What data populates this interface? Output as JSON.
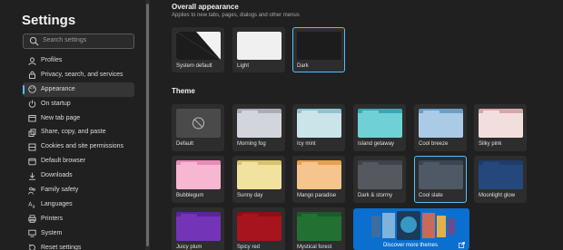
{
  "sidebar": {
    "title": "Settings",
    "search_placeholder": "Search settings",
    "items": [
      {
        "label": "Profiles",
        "icon": "profile-icon"
      },
      {
        "label": "Privacy, search, and services",
        "icon": "lock-icon"
      },
      {
        "label": "Appearance",
        "icon": "palette-icon",
        "active": true
      },
      {
        "label": "On startup",
        "icon": "power-icon"
      },
      {
        "label": "New tab page",
        "icon": "new-tab-icon"
      },
      {
        "label": "Share, copy, and paste",
        "icon": "share-icon"
      },
      {
        "label": "Cookies and site permissions",
        "icon": "cookies-icon"
      },
      {
        "label": "Default browser",
        "icon": "browser-icon"
      },
      {
        "label": "Downloads",
        "icon": "download-icon"
      },
      {
        "label": "Family safety",
        "icon": "family-icon"
      },
      {
        "label": "Languages",
        "icon": "languages-icon"
      },
      {
        "label": "Printers",
        "icon": "printer-icon"
      },
      {
        "label": "System",
        "icon": "system-icon"
      },
      {
        "label": "Reset settings",
        "icon": "reset-icon"
      }
    ]
  },
  "appearance": {
    "heading": "Overall appearance",
    "subtext": "Applies to new tabs, pages, dialogs and other menus",
    "options": [
      {
        "label": "System default",
        "selected": false
      },
      {
        "label": "Light",
        "selected": false
      },
      {
        "label": "Dark",
        "selected": true
      }
    ]
  },
  "theme": {
    "heading": "Theme",
    "items": [
      {
        "label": "Default",
        "colors": {
          "bar": "#4d4d4d",
          "body": "#4d4d4d",
          "tab": "#4d4d4d"
        }
      },
      {
        "label": "Morning fog",
        "colors": {
          "bar": "#a9adb5",
          "body": "#d2d6dc",
          "tab": "#d2d6dc"
        }
      },
      {
        "label": "Icy mint",
        "colors": {
          "bar": "#8fc3d0",
          "body": "#cbe4ea",
          "tab": "#cbe4ea"
        }
      },
      {
        "label": "Island getaway",
        "colors": {
          "bar": "#3aa7b5",
          "body": "#6fd1d6",
          "tab": "#6fd1d6"
        }
      },
      {
        "label": "Cool breeze",
        "colors": {
          "bar": "#6e9ec4",
          "body": "#a9cbe6",
          "tab": "#a9cbe6"
        }
      },
      {
        "label": "Silky pink",
        "colors": {
          "bar": "#d7a8a8",
          "body": "#f3dede",
          "tab": "#f3dede"
        }
      },
      {
        "label": "Bubblegum",
        "colors": {
          "bar": "#e88bb6",
          "body": "#f7b6d2",
          "tab": "#f7b6d2"
        }
      },
      {
        "label": "Sunny day",
        "colors": {
          "bar": "#d8c36b",
          "body": "#f1e2a0",
          "tab": "#f1e2a0"
        }
      },
      {
        "label": "Mango paradise",
        "colors": {
          "bar": "#e7a14d",
          "body": "#f6c48d",
          "tab": "#f6c48d"
        }
      },
      {
        "label": "Dark & stormy",
        "colors": {
          "bar": "#3f4248",
          "body": "#55585e",
          "tab": "#55585e"
        }
      },
      {
        "label": "Cool slate",
        "colors": {
          "bar": "#3b4452",
          "body": "#4f5966",
          "tab": "#4f5966"
        }
      },
      {
        "label": "Moonlight glow",
        "colors": {
          "bar": "#1f3b67",
          "body": "#24487c",
          "tab": "#24487c"
        }
      },
      {
        "label": "Juicy plum",
        "colors": {
          "bar": "#5b2596",
          "body": "#7434b8",
          "tab": "#7434b8"
        }
      },
      {
        "label": "Spicy red",
        "colors": {
          "bar": "#8c0f16",
          "body": "#a8141d",
          "tab": "#a8141d"
        }
      },
      {
        "label": "Mystical forest",
        "colors": {
          "bar": "#1b5a2a",
          "body": "#237033",
          "tab": "#237033"
        }
      }
    ],
    "selected_index": 10,
    "discover_label": "Discover more themes"
  },
  "colors": {
    "accent": "#4cc2ff",
    "promo": "#0b6fcf"
  }
}
